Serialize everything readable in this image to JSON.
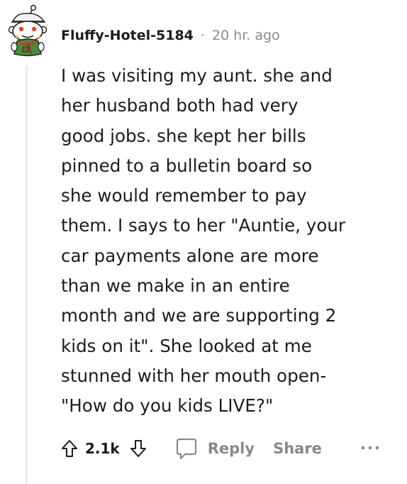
{
  "comment": {
    "username": "Fluffy-Hotel-5184",
    "separator": "·",
    "timestamp": "20 hr. ago",
    "lines": [
      "I was visiting my aunt. she and",
      "her husband both had very",
      "good jobs. she kept her bills",
      "pinned to a bulletin board so",
      "she would remember to pay",
      "them. I says to her \"Auntie, your",
      "car payments alone are more",
      "than we make in an entire",
      "month and we are supporting 2",
      "kids on it\". She looked at me",
      "stunned with her mouth open-",
      "\"How do you kids LIVE?\""
    ]
  },
  "actions": {
    "score": "2.1k",
    "reply_label": "Reply",
    "share_label": "Share"
  },
  "icons": {
    "avatar": "snoo-avatar-icon",
    "upvote": "upvote-arrow-icon",
    "downvote": "downvote-arrow-icon",
    "reply": "speech-bubble-icon",
    "more": "more-dots-icon"
  },
  "colors": {
    "text": "#1c1c1c",
    "muted": "#878a8c",
    "thread_line": "#ededed"
  }
}
